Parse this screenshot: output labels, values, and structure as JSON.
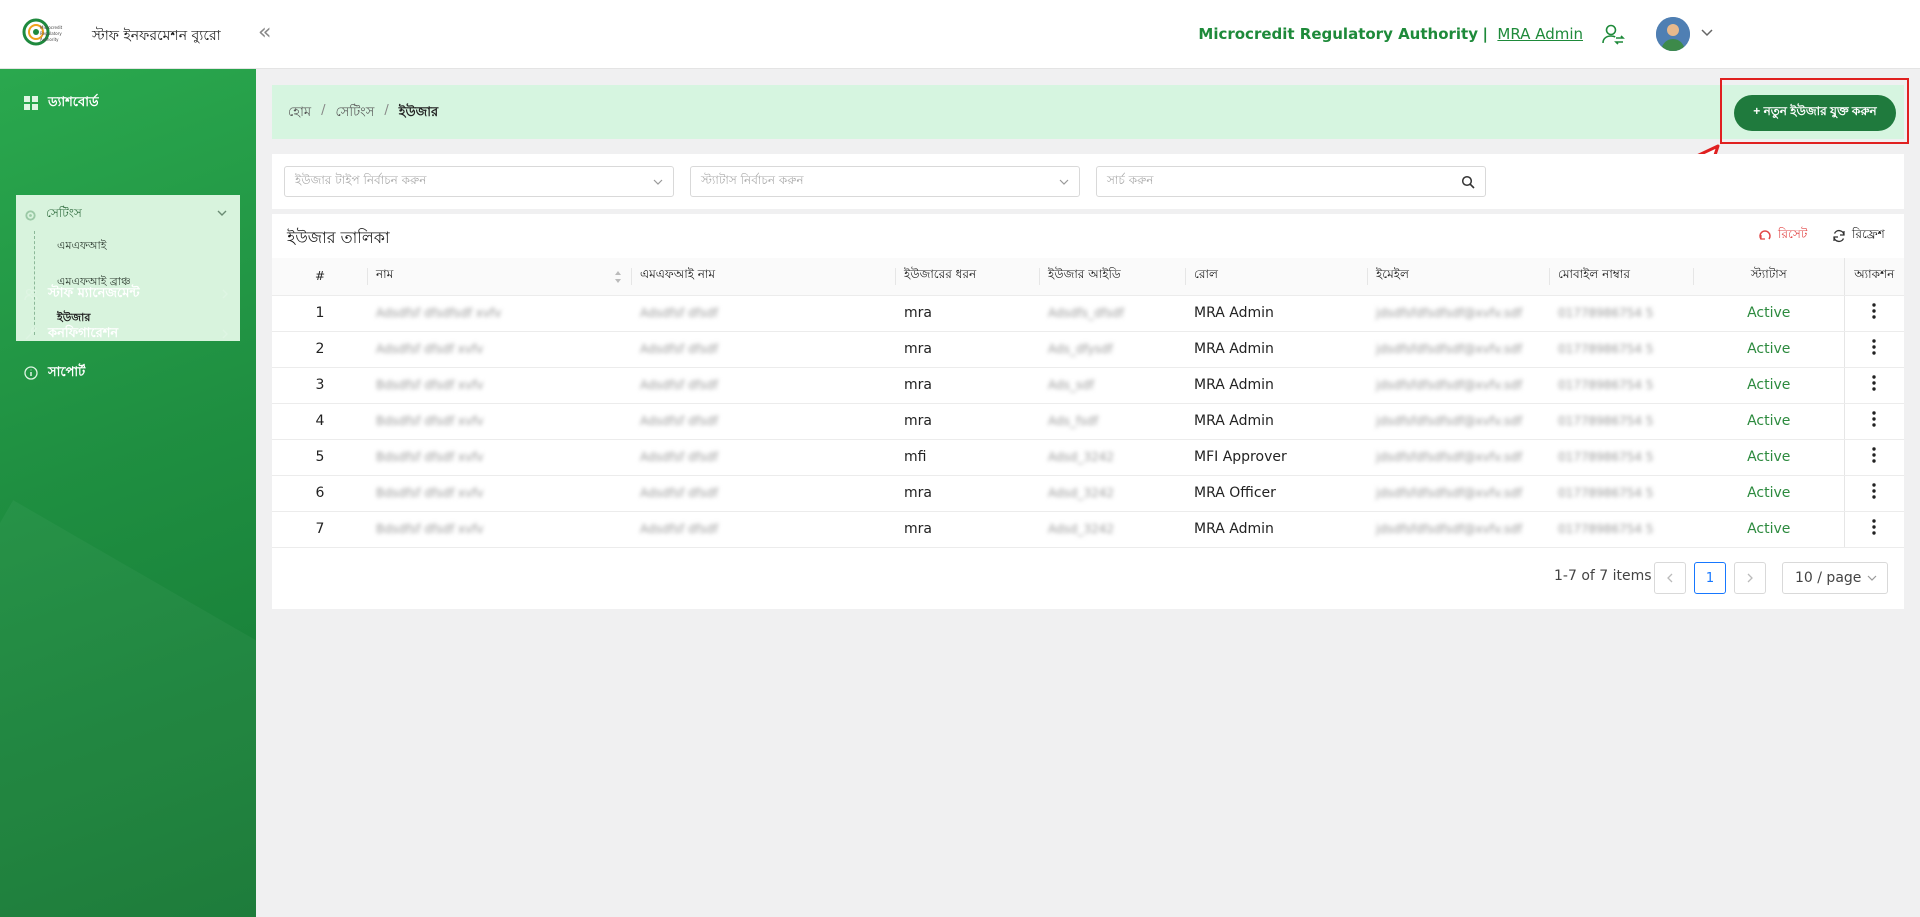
{
  "header": {
    "app_title": "স্টাফ ইনফরমেশন ব্যুরো",
    "logo_text": "Microcredit Regulatory Authority",
    "org_name": "Microcredit Regulatory Authority",
    "org_separator": "|",
    "user_name": "MRA Admin"
  },
  "sidebar": {
    "dashboard": "ড্যাশবোর্ড",
    "settings": "সেটিংস",
    "settings_items": [
      "এমএফআই",
      "এমএফআই ব্রাঞ্চ",
      "ইউজার"
    ],
    "staff_management": "স্টাফ ম্যানেজমেন্ট",
    "configuration": "কনফিগারেশন",
    "support": "সাপোর্ট"
  },
  "breadcrumb": [
    "হোম",
    "সেটিংস",
    "ইউজার"
  ],
  "add_button": "+ নতুন ইউজার যুক্ত করুন",
  "filters": {
    "user_type_placeholder": "ইউজার টাইপ নির্বাচন করুন",
    "status_placeholder": "স্ট্যাটাস নির্বাচন করুন",
    "search_placeholder": "সার্চ করুন"
  },
  "table": {
    "title": "ইউজার তালিকা",
    "reset": "রিসেট",
    "refresh": "রিফ্রেশ",
    "columns": [
      "#",
      "নাম",
      "এমএফআই নাম",
      "ইউজারের ধরন",
      "ইউজার আইডি",
      "রোল",
      "ইমেইল",
      "মোবাইল নাম্বার",
      "স্ট্যাটাস",
      "অ্যাকশন"
    ],
    "rows": [
      {
        "num": "1",
        "name": "Adsdfsf dfsdfsdf xvfv",
        "mfi": "Adsdfsf dfsdf",
        "type": "mra",
        "uid": "Adsdfs_dfsdf",
        "role": "MRA Admin",
        "email": "jdsdfsfdfsdfsdf@xvfv.sdf",
        "mobile": "01778986754 5",
        "status": "Active"
      },
      {
        "num": "2",
        "name": "Adsdfsf dfsdf xvfv",
        "mfi": "Adsdfsf dfsdf",
        "type": "mra",
        "uid": "Ads_dfysdf",
        "role": "MRA Admin",
        "email": "jdsdfsfdfsdfsdf@xvfv.sdf",
        "mobile": "01778986754 5",
        "status": "Active"
      },
      {
        "num": "3",
        "name": "Bdsdfsf dfsdf xvfv",
        "mfi": "Adsdfsf dfsdf",
        "type": "mra",
        "uid": "Ads_sdf",
        "role": "MRA Admin",
        "email": "jdsdfsfdfsdfsdf@xvfv.sdf",
        "mobile": "01778986754 5",
        "status": "Active"
      },
      {
        "num": "4",
        "name": "Bdsdfsf dfsdf xvfv",
        "mfi": "Adsdfsf dfsdf",
        "type": "mra",
        "uid": "Ads_fsdf",
        "role": "MRA Admin",
        "email": "jdsdfsfdfsdfsdf@xvfv.sdf",
        "mobile": "01778986754 5",
        "status": "Active"
      },
      {
        "num": "5",
        "name": "Bdsdfsf dfsdf xvfv",
        "mfi": "Adsdfsf dfsdf",
        "type": "mfi",
        "uid": "Adsd_3242",
        "role": "MFI Approver",
        "email": "jdsdfsfdfsdfsdf@xvfv.sdf",
        "mobile": "01778986754 5",
        "status": "Active"
      },
      {
        "num": "6",
        "name": "Bdsdfsf dfsdf xvfv",
        "mfi": "Adsdfsf dfsdf",
        "type": "mra",
        "uid": "Adsd_3242",
        "role": "MRA Officer",
        "email": "jdsdfsfdfsdfsdf@xvfv.sdf",
        "mobile": "01778986754 5",
        "status": "Active"
      },
      {
        "num": "7",
        "name": "Bdsdfsf dfsdf xvfv",
        "mfi": "Adsdfsf dfsdf",
        "type": "mra",
        "uid": "Adsd_3242",
        "role": "MRA Admin",
        "email": "jdsdfsfdfsdfsdf@xvfv.sdf",
        "mobile": "01778986754 5",
        "status": "Active"
      }
    ]
  },
  "pagination": {
    "info": "1-7 of 7 items",
    "current_page": "1",
    "page_size": "10 / page"
  },
  "colors": {
    "brand_green": "#1f7a3d",
    "status_green": "#2c8a3e",
    "highlight_red": "#e02020"
  }
}
